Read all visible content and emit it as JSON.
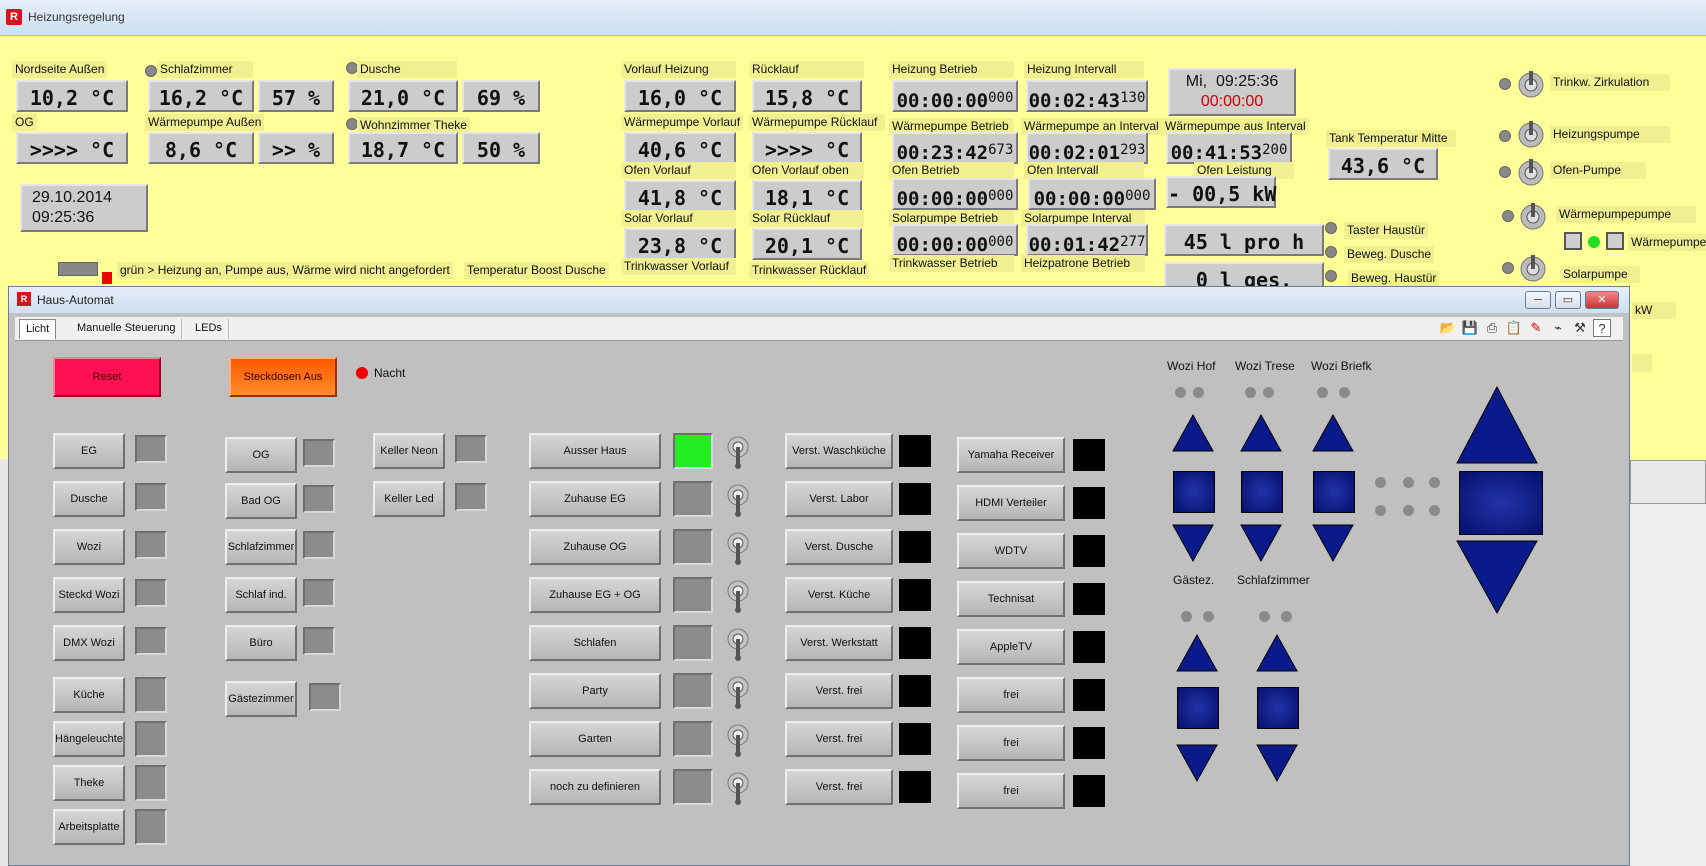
{
  "main_window": {
    "title": "Heizungsregelung",
    "app_icon": "heating-app-icon"
  },
  "sensors": [
    {
      "id": "nordseite",
      "label": "Nordseite Außen",
      "value": "10,2 °C"
    },
    {
      "id": "og",
      "label": "OG",
      "value": ">>>> °C"
    },
    {
      "id": "schlafzimmer",
      "label": "Schlafzimmer",
      "value": "16,2 °C",
      "hum": "57 %"
    },
    {
      "id": "wp-aussen",
      "label": "Wärmepumpe Außen",
      "value": "8,6 °C",
      "hum": ">> %"
    },
    {
      "id": "dusche",
      "label": "Dusche",
      "value": "21,0 °C",
      "hum": "69 %"
    },
    {
      "id": "wohnzimmer",
      "label": "Wohnzimmer Theke",
      "value": "18,7 °C",
      "hum": "50 %"
    },
    {
      "id": "vorlauf-heizung",
      "label": "Vorlauf Heizung",
      "value": "16,0 °C"
    },
    {
      "id": "wp-vorlauf",
      "label": "Wärmepumpe Vorlauf",
      "value": "40,6 °C"
    },
    {
      "id": "ofen-vorlauf",
      "label": "Ofen Vorlauf",
      "value": "41,8 °C"
    },
    {
      "id": "solar-vorlauf",
      "label": "Solar Vorlauf",
      "value": "23,8 °C"
    },
    {
      "id": "trinkwasser-vorlauf",
      "label": "Trinkwasser Vorlauf"
    },
    {
      "id": "ruecklauf",
      "label": "Rücklauf",
      "value": "15,8 °C"
    },
    {
      "id": "wp-ruecklauf",
      "label": "Wärmepumpe Rücklauf",
      "value": ">>>> °C"
    },
    {
      "id": "ofen-vorlauf-oben",
      "label": "Ofen Vorlauf oben",
      "value": "18,1 °C"
    },
    {
      "id": "solar-ruecklauf",
      "label": "Solar Rücklauf",
      "value": "20,1 °C"
    },
    {
      "id": "trinkwasser-ruecklauf",
      "label": "Trinkwasser Rücklauf"
    },
    {
      "id": "tank-mitte",
      "label": "Tank Temperatur Mitte",
      "value": "43,6 °C"
    }
  ],
  "timers": [
    {
      "id": "heizung-betrieb",
      "label": "Heizung Betrieb",
      "time": "00:00:00",
      "ms": "000"
    },
    {
      "id": "heizung-intervall",
      "label": "Heizung Intervall",
      "time": "00:02:43",
      "ms": "130"
    },
    {
      "id": "wp-betrieb",
      "label": "Wärmepumpe Betrieb",
      "time": "00:23:42",
      "ms": "673"
    },
    {
      "id": "wp-an-interval",
      "label": "Wärmepumpe an Interval",
      "time": "00:02:01",
      "ms": "293"
    },
    {
      "id": "wp-aus-interval",
      "label": "Wärmepumpe aus Interval",
      "time": "00:41:53",
      "ms": "200"
    },
    {
      "id": "ofen-betrieb",
      "label": "Ofen Betrieb",
      "time": "00:00:00",
      "ms": "000"
    },
    {
      "id": "ofen-intervall",
      "label": "Ofen Intervall",
      "time": "00:00:00",
      "ms": "000"
    },
    {
      "id": "solarpumpe-betrieb",
      "label": "Solarpumpe Betrieb",
      "time": "00:00:00",
      "ms": "000"
    },
    {
      "id": "solarpumpe-interval",
      "label": "Solarpumpe Interval",
      "time": "00:01:42",
      "ms": "277"
    },
    {
      "id": "trinkwasser-betrieb",
      "label": "Trinkwasser Betrieb"
    },
    {
      "id": "heizpatrone-betrieb",
      "label": "Heizpatrone Betrieb"
    }
  ],
  "clock": {
    "day": "Mi,",
    "time": "09:25:36",
    "elapsed": "00:00:00"
  },
  "datetime": {
    "date": "29.10.2014",
    "time": "09:25:36"
  },
  "ofen_leistung": {
    "label": "Ofen Leistung",
    "value": "- 00,5 kW"
  },
  "flow": {
    "rate": "45  l pro h",
    "total": "0  l ges."
  },
  "pumps": [
    "Trinkw. Zirkulation",
    "Heizungspumpe",
    "Ofen-Pumpe",
    "Wärmepumpepumpe",
    "Solarpumpe"
  ],
  "wp_right_label": "Wärmepumpe",
  "kw_fragment": "kW",
  "inputs": [
    "Taster Haustür",
    "Beweg. Dusche",
    "Beweg. Haustür"
  ],
  "legend_text": "grün > Heizung an, Pumpe aus, Wärme wird nicht angefordert",
  "boost_label": "Temperatur Boost Dusche",
  "haus": {
    "title": "Haus-Automat",
    "tabs": [
      "Licht",
      "Manuelle Steuerung",
      "LEDs"
    ],
    "reset_label": "Reset",
    "steckdosen_label": "Steckdosen Aus",
    "nacht_label": "Nacht",
    "col1": [
      "EG",
      "Dusche",
      "Wozi",
      "Steckd Wozi",
      "DMX Wozi",
      "Küche",
      "Hängeleuchte",
      "Theke",
      "Arbeitsplatte"
    ],
    "col2": [
      "OG",
      "Bad OG",
      "Schlafzimmer",
      "Schlaf ind.",
      "Büro",
      "Gästezimmer"
    ],
    "col3": [
      "Keller Neon",
      "Keller Led"
    ],
    "scenes": [
      "Ausser Haus",
      "Zuhause  EG",
      "Zuhause OG",
      "Zuhause EG + OG",
      "Schlafen",
      "Party",
      "Garten",
      "noch zu definieren"
    ],
    "verst": [
      "Verst. Waschküche",
      "Verst. Labor",
      "Verst. Dusche",
      "Verst. Küche",
      "Verst. Werkstatt",
      "Verst. frei",
      "Verst. frei",
      "Verst. frei"
    ],
    "devices": [
      "Yamaha Receiver",
      "HDMI Verteiler",
      "WDTV",
      "Technisat",
      "AppleTV",
      "frei",
      "frei",
      "frei"
    ],
    "blinds": [
      "Wozi Hof",
      "Wozi Trese",
      "Wozi Briefk",
      "Gästez.",
      "Schlafzimmer"
    ],
    "colors": {
      "scene_active": "#22ee22",
      "reset": "#ff1050",
      "steckdosen": "#ff6600",
      "nacht_dot": "#ee0000"
    }
  }
}
